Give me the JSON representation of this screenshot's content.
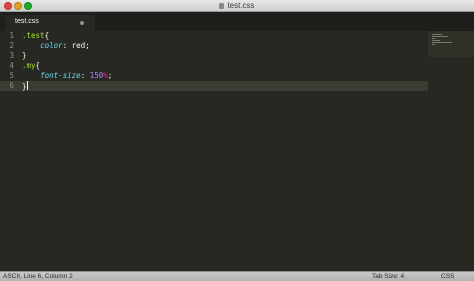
{
  "window": {
    "title": "test.css"
  },
  "tabs": [
    {
      "label": "test.css",
      "modified_indicator": "dot"
    }
  ],
  "editor": {
    "line_numbers": [
      "1",
      "2",
      "3",
      "4",
      "5",
      "6"
    ],
    "active_line": 6,
    "lines": [
      {
        "selector": ".test",
        "open": "{"
      },
      {
        "property": "color",
        "colon": ": ",
        "value": "red",
        "semicolon": ";"
      },
      {
        "close": "}"
      },
      {
        "selector": ".my",
        "open": "{"
      },
      {
        "property": "font-size",
        "colon": ": ",
        "number": "150",
        "percent": "%",
        "semicolon": ";"
      },
      {
        "close": "}"
      }
    ]
  },
  "status_bar": {
    "position": "ASCII, Line 6, Column 2",
    "tab_size": "Tab Size: 4",
    "syntax": "CSS"
  },
  "colors": {
    "background": "#272822",
    "selector": "#a6e22e",
    "property": "#66d9ef",
    "number": "#ae81ff",
    "unit": "#f92672"
  }
}
